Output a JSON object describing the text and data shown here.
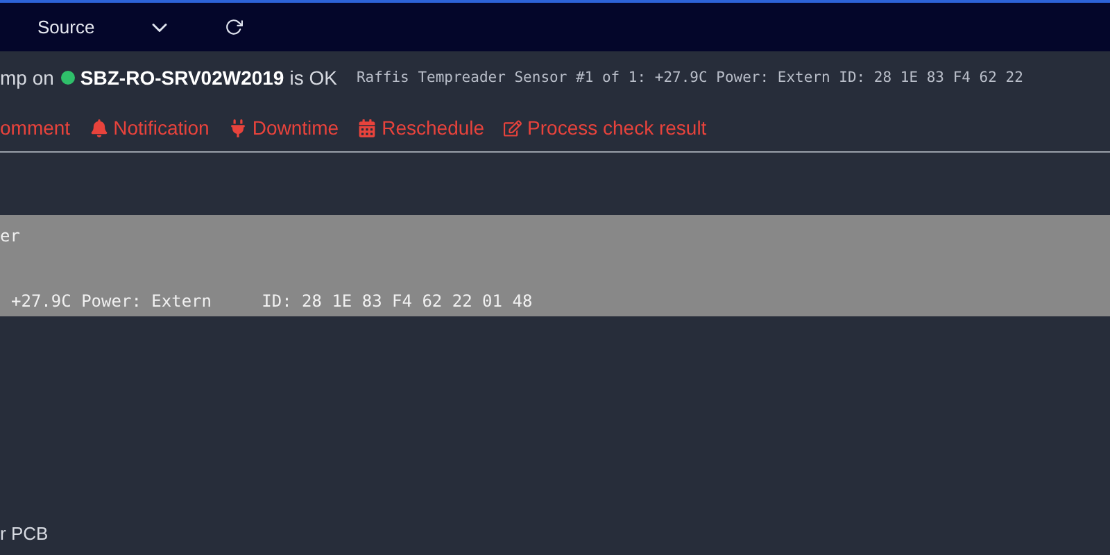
{
  "toolbar": {
    "items": [
      {
        "kind": "text",
        "label": "Source"
      },
      {
        "kind": "chevron"
      },
      {
        "kind": "refresh"
      }
    ]
  },
  "status": {
    "prefix": "mp on",
    "host": "SBZ-RO-SRV02W2019",
    "state": "is OK",
    "ok": true,
    "output": "Raffis Tempreader Sensor #1 of 1: +27.9C Power: Extern ID: 28 1E 83 F4 62 22"
  },
  "actions": [
    {
      "kind": "comment",
      "label": "omment"
    },
    {
      "kind": "bell",
      "label": "Notification"
    },
    {
      "kind": "plug",
      "label": "Downtime"
    },
    {
      "kind": "calendar",
      "label": "Reschedule"
    },
    {
      "kind": "edit",
      "label": "Process check result"
    }
  ],
  "output_block": {
    "lines": [
      "er",
      "+27.9C Power: Extern     ID: 28 1E 83 F4 62 22 01 48"
    ]
  },
  "footer": {
    "text": "r PCB"
  }
}
